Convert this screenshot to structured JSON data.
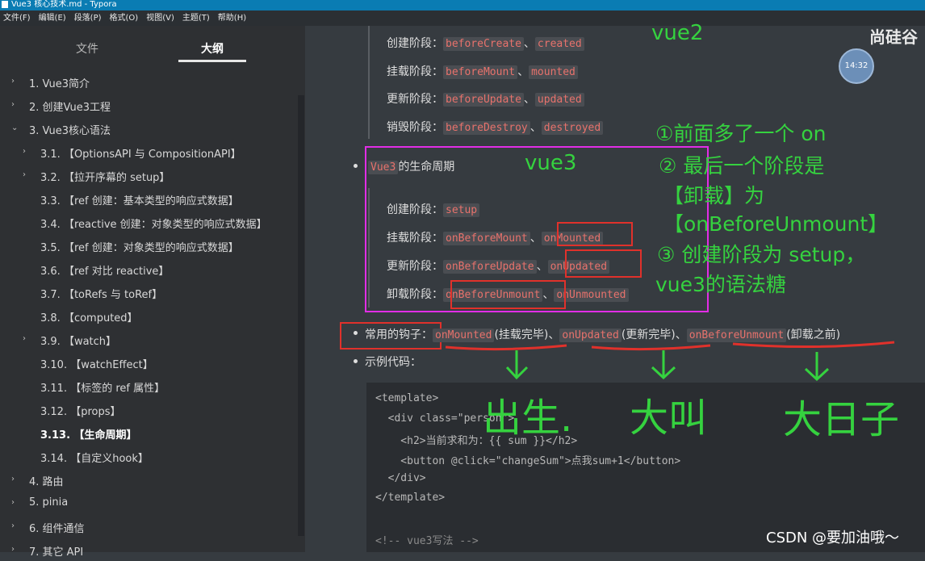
{
  "window": {
    "title": "Vue3 核心技术.md - Typora"
  },
  "menu": [
    "文件(F)",
    "编辑(E)",
    "段落(P)",
    "格式(O)",
    "视图(V)",
    "主题(T)",
    "帮助(H)"
  ],
  "sidebar": {
    "tab_files": "文件",
    "tab_outline": "大纲",
    "items": [
      {
        "label": "1. Vue3简介",
        "chev": "›"
      },
      {
        "label": "2. 创建Vue3工程",
        "chev": "›"
      },
      {
        "label": "3. Vue3核心语法",
        "chev": "⌄"
      },
      {
        "label": "3.1. 【OptionsAPI 与 CompositionAPI】",
        "chev": "›"
      },
      {
        "label": "3.2. 【拉开序幕的 setup】",
        "chev": "›"
      },
      {
        "label": "3.3. 【ref 创建：基本类型的响应式数据】",
        "chev": ""
      },
      {
        "label": "3.4. 【reactive 创建：对象类型的响应式数据】",
        "chev": ""
      },
      {
        "label": "3.5. 【ref 创建：对象类型的响应式数据】",
        "chev": ""
      },
      {
        "label": "3.6. 【ref 对比 reactive】",
        "chev": ""
      },
      {
        "label": "3.7. 【toRefs 与 toRef】",
        "chev": ""
      },
      {
        "label": "3.8. 【computed】",
        "chev": ""
      },
      {
        "label": "3.9. 【watch】",
        "chev": "›"
      },
      {
        "label": "3.10. 【watchEffect】",
        "chev": ""
      },
      {
        "label": "3.11. 【标签的 ref 属性】",
        "chev": ""
      },
      {
        "label": "3.12. 【props】",
        "chev": ""
      },
      {
        "label": "3.13. 【生命周期】",
        "chev": ""
      },
      {
        "label": "3.14. 【自定义hook】",
        "chev": ""
      },
      {
        "label": "4. 路由",
        "chev": "›"
      },
      {
        "label": "5. pinia",
        "chev": "›"
      },
      {
        "label": "6. 组件通信",
        "chev": "›"
      },
      {
        "label": "7. 其它 API",
        "chev": "›"
      }
    ]
  },
  "vue2": {
    "create": {
      "label": "创建阶段：",
      "a": "beforeCreate",
      "b": "created"
    },
    "mount": {
      "label": "挂载阶段：",
      "a": "beforeMount",
      "b": "mounted"
    },
    "update": {
      "label": "更新阶段：",
      "a": "beforeUpdate",
      "b": "updated"
    },
    "destroy": {
      "label": "销毁阶段：",
      "a": "beforeDestroy",
      "b": "destroyed"
    }
  },
  "vue3": {
    "heading_code": "Vue3",
    "heading_text": "的生命周期",
    "create": {
      "label": "创建阶段：",
      "a": "setup"
    },
    "mount": {
      "label": "挂载阶段：",
      "a": "onBeforeMount",
      "b": "onMounted"
    },
    "update": {
      "label": "更新阶段：",
      "a": "onBeforeUpdate",
      "b": "onUpdated"
    },
    "unmount": {
      "label": "卸载阶段：",
      "a": "onBeforeUnmount",
      "b": "onUnmounted"
    }
  },
  "hooks": {
    "label": "常用的钩子：",
    "h1": "onMounted",
    "h1_note": "(挂载完毕)",
    "h2": "onUpdated",
    "h2_note": "(更新完毕)",
    "h3": "onBeforeUnmount",
    "h3_note": "(卸载之前)",
    "sep": "、"
  },
  "example_label": "示例代码：",
  "code_lines": [
    "<template>",
    "  <div class=\"person\">",
    "    <h2>当前求和为：{{ sum }}</h2>",
    "    <button @click=\"changeSum\">点我sum+1</button>",
    "  </div>",
    "</template>",
    "",
    "<!-- vue3写法 -->"
  ],
  "annotations": {
    "vue2": "vue2",
    "vue3": "vue3",
    "note1": "①前面多了一个 on",
    "note2": "② 最后一个阶段是",
    "note3": "【卸载】为",
    "note4": "【onBeforeUnmount】",
    "note5": "③ 创建阶段为 setup，",
    "note6": "vue3的语法糖",
    "birth": "出生.",
    "big1": "大叫",
    "big2": "大日子"
  },
  "clock": "14:32",
  "logo_text": "尚硅谷",
  "watermark": "CSDN @要加油哦～",
  "colors": {
    "annotation_green": "#35d23f",
    "box_red": "#e0312b",
    "box_magenta": "#e22de6",
    "code_red": "#e8726c"
  }
}
